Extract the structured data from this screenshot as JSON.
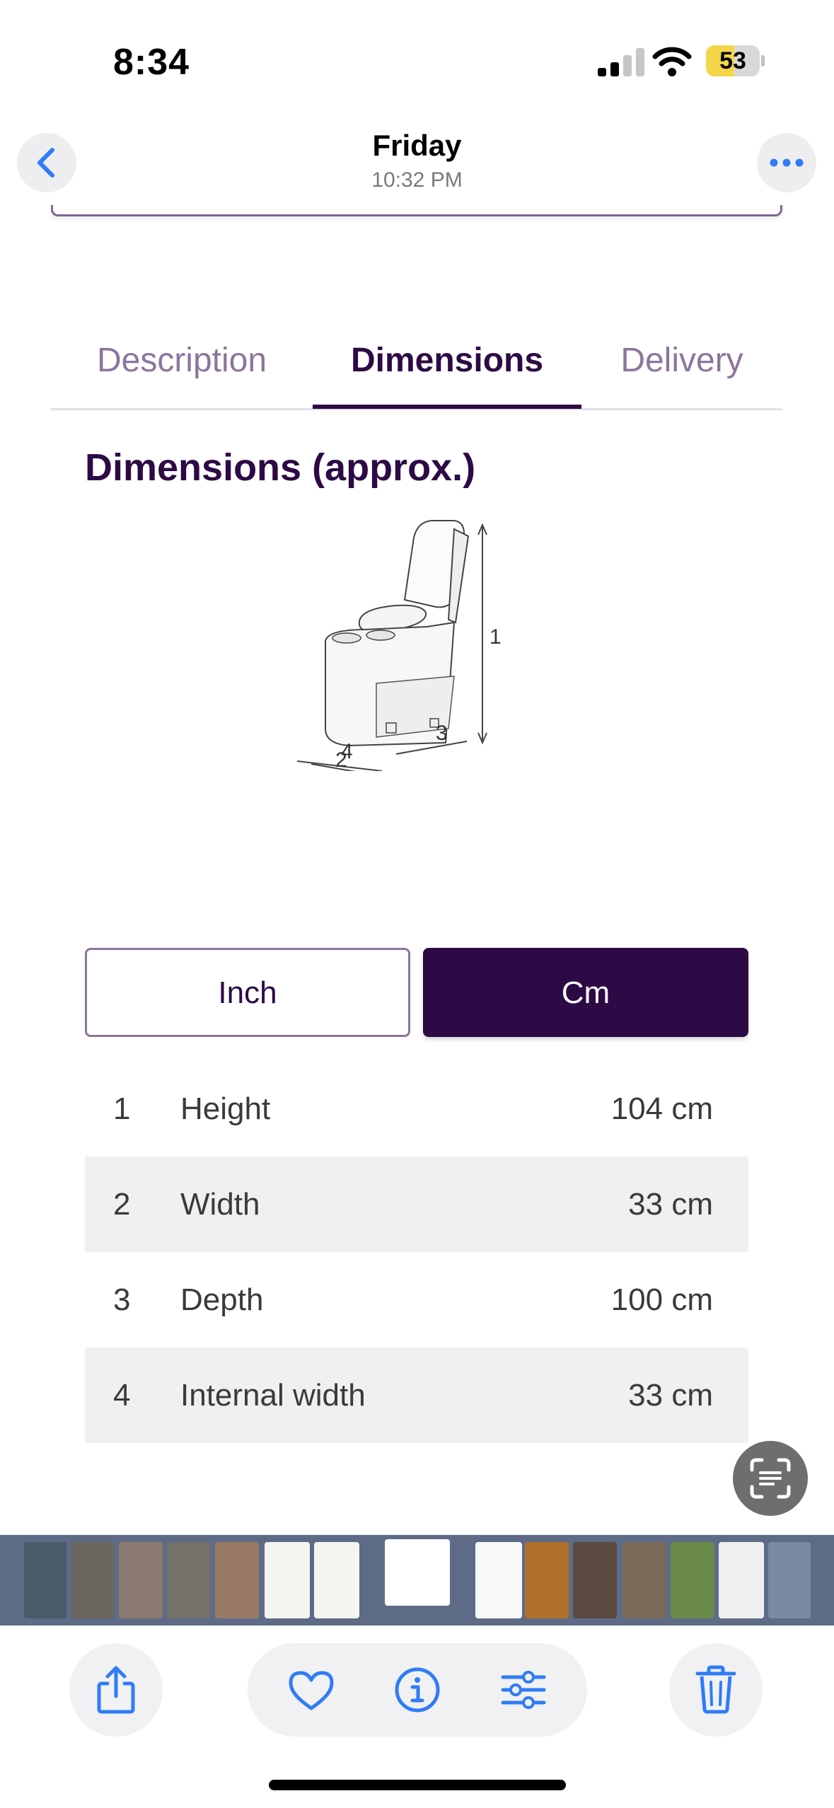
{
  "status_bar": {
    "time": "8:34",
    "battery_level": "53",
    "battery_fraction": 0.53
  },
  "header": {
    "title": "Friday",
    "subtitle": "10:32 PM",
    "back_icon": "chevron-left-icon",
    "more_icon": "ellipsis-icon"
  },
  "tabs": [
    {
      "label": "Description",
      "active": false
    },
    {
      "label": "Dimensions",
      "active": true
    },
    {
      "label": "Delivery",
      "active": false
    }
  ],
  "section_title": "Dimensions (approx.)",
  "diagram": {
    "labels": [
      "1",
      "2",
      "3",
      "4"
    ]
  },
  "unit_toggle": {
    "inch_label": "Inch",
    "cm_label": "Cm",
    "selected": "Cm"
  },
  "dimensions": [
    {
      "num": "1",
      "label": "Height",
      "value": "104 cm"
    },
    {
      "num": "2",
      "label": "Width",
      "value": "33 cm"
    },
    {
      "num": "3",
      "label": "Depth",
      "value": "100 cm"
    },
    {
      "num": "4",
      "label": "Internal width",
      "value": "33 cm"
    }
  ],
  "toolbar": {
    "icons": [
      "share-icon",
      "heart-icon",
      "info-icon",
      "adjust-icon",
      "trash-icon"
    ]
  },
  "colors": {
    "brand_purple": "#2d0a45",
    "muted_purple": "#8b759e",
    "ios_blue": "#2f7cf6",
    "row_shade": "#f0f0f2",
    "strip_bg": "#5e6b87"
  }
}
